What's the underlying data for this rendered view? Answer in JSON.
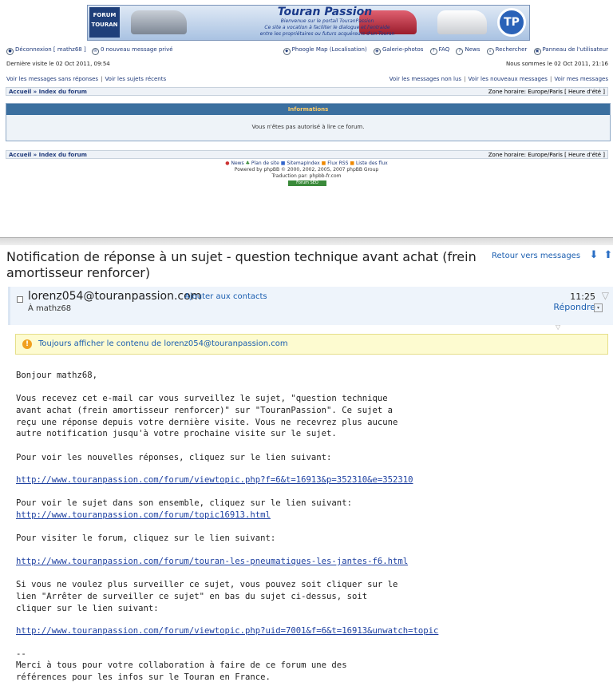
{
  "forum": {
    "banner": {
      "logo_text": "FORUM TOURAN",
      "title": "Touran Passion",
      "subtitle_lines": [
        "Bienvenue sur le portail TouranPassion",
        "Ce site a vocation à faciliter le dialogue et l'entraide",
        "entre les propriétaires ou futurs acquéreurs d'un Touran"
      ],
      "seal_text": "TP"
    },
    "nav_left": [
      "Déconnexion [ mathz68 ]",
      "0 nouveau message privé"
    ],
    "nav_right": [
      "Phoogle Map (Localisation)",
      "Galerie-photos",
      "FAQ",
      "News",
      "Rechercher",
      "Panneau de l'utilisateur"
    ],
    "last_visit": "Dernière visite le 02 Oct 2011, 09:54",
    "now": "Nous sommes le 02 Oct 2011, 21:16",
    "links_left": [
      "Voir les messages sans réponses",
      "Voir les sujets récents"
    ],
    "links_right": [
      "Voir les messages non lus",
      "Voir les nouveaux messages",
      "Voir mes messages"
    ],
    "breadcrumb": "Accueil » Index du forum",
    "timezone": "Zone horaire: Europe/Paris [ Heure d'été ]",
    "info_title": "Informations",
    "info_message": "Vous n'êtes pas autorisé à lire ce forum.",
    "footer_links": [
      "News",
      "Plan de site",
      "SitemapIndex",
      "Flux RSS",
      "Liste des flux"
    ],
    "powered": "Powered by phpBB © 2000, 2002, 2005, 2007 phpBB Group",
    "translation": "Traduction par: phpbb-fr.com",
    "badge": "Forum SEO"
  },
  "mail": {
    "subject": "Notification de réponse à un sujet - question technique avant achat (frein amortisseur renforcer)",
    "back_link": "Retour vers messages",
    "from": "lorenz054@touranpassion.com",
    "add_contact": "Ajouter aux contacts",
    "to": "À mathz68",
    "time": "11:25",
    "reply": "Répondre",
    "notice": "Toujours afficher le contenu de lorenz054@touranpassion.com",
    "greeting": "Bonjour mathz68,",
    "para1": "Vous recevez cet e-mail car vous surveillez le sujet, \"question technique\navant achat (frein amortisseur renforcer)\" sur \"TouranPassion\". Ce sujet a\nreçu une réponse depuis votre dernière visite. Vous ne recevrez plus aucune\nautre notification jusqu'à votre prochaine visite sur le sujet.",
    "para2": "Pour voir les nouvelles réponses, cliquez sur le lien suivant:",
    "link1": "http://www.touranpassion.com/forum/viewtopic.php?f=6&t=16913&p=352310&e=352310",
    "para3": "Pour voir le sujet dans son ensemble, cliquez sur le lien suivant:",
    "link2": "http://www.touranpassion.com/forum/topic16913.html",
    "para4": "Pour visiter le forum, cliquez sur le lien suivant:",
    "link3": "http://www.touranpassion.com/forum/touran-les-pneumatiques-les-jantes-f6.html",
    "para5": "Si vous ne voulez plus surveiller ce sujet, vous pouvez soit cliquer sur le\nlien \"Arrêter de surveiller ce sujet\" en bas du sujet ci-dessus, soit\ncliquer sur le lien suivant:",
    "link4": "http://www.touranpassion.com/forum/viewtopic.php?uid=7001&f=6&t=16913&unwatch=topic",
    "sig_dash": "--",
    "closing": "Merci à tous pour votre collaboration à faire de ce forum une des\nréférences pour les infos sur le Touran en France."
  }
}
